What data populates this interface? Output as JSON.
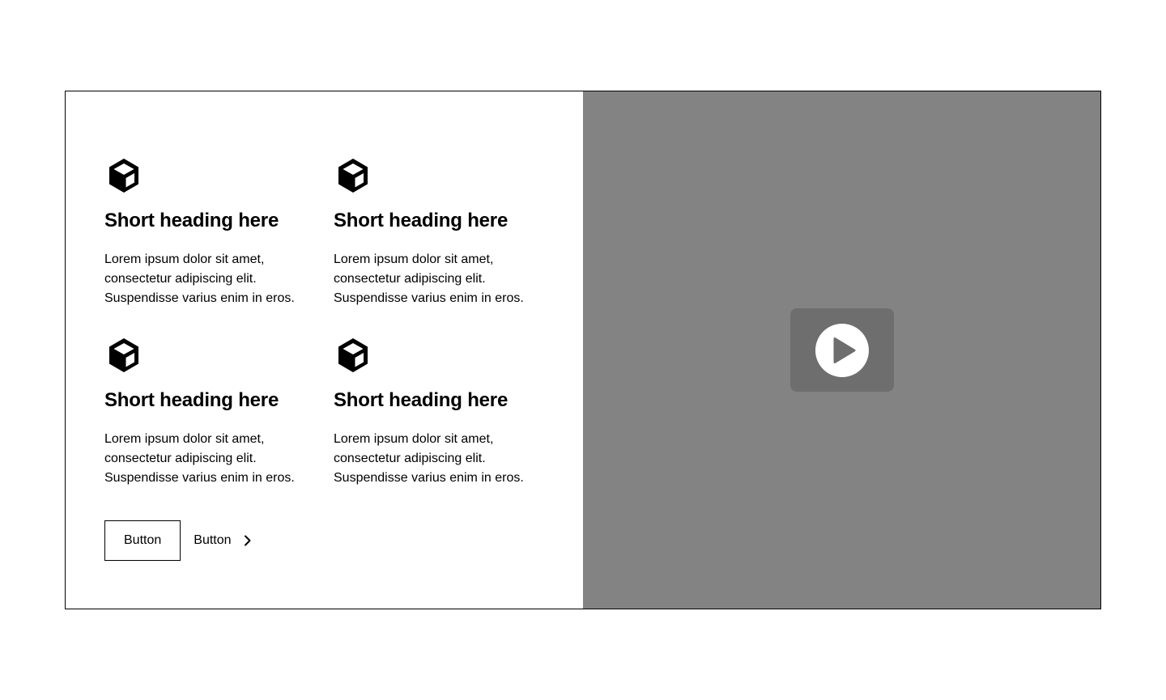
{
  "features": [
    {
      "icon": "cube-icon",
      "heading": "Short heading here",
      "text": "Lorem ipsum dolor sit amet, consectetur adipiscing elit. Suspendisse varius enim in eros."
    },
    {
      "icon": "cube-icon",
      "heading": "Short heading here",
      "text": "Lorem ipsum dolor sit amet, consectetur adipiscing elit. Suspendisse varius enim in eros."
    },
    {
      "icon": "cube-icon",
      "heading": "Short heading here",
      "text": "Lorem ipsum dolor sit amet, consectetur adipiscing elit. Suspendisse varius enim in eros."
    },
    {
      "icon": "cube-icon",
      "heading": "Short heading here",
      "text": "Lorem ipsum dolor sit amet, consectetur adipiscing elit. Suspendisse varius enim in eros."
    }
  ],
  "actions": {
    "primary_label": "Button",
    "link_label": "Button",
    "link_icon": "chevron-right-icon"
  },
  "media": {
    "icon": "play-icon",
    "background_color": "#838383",
    "play_box_color": "#6e6e6e"
  }
}
